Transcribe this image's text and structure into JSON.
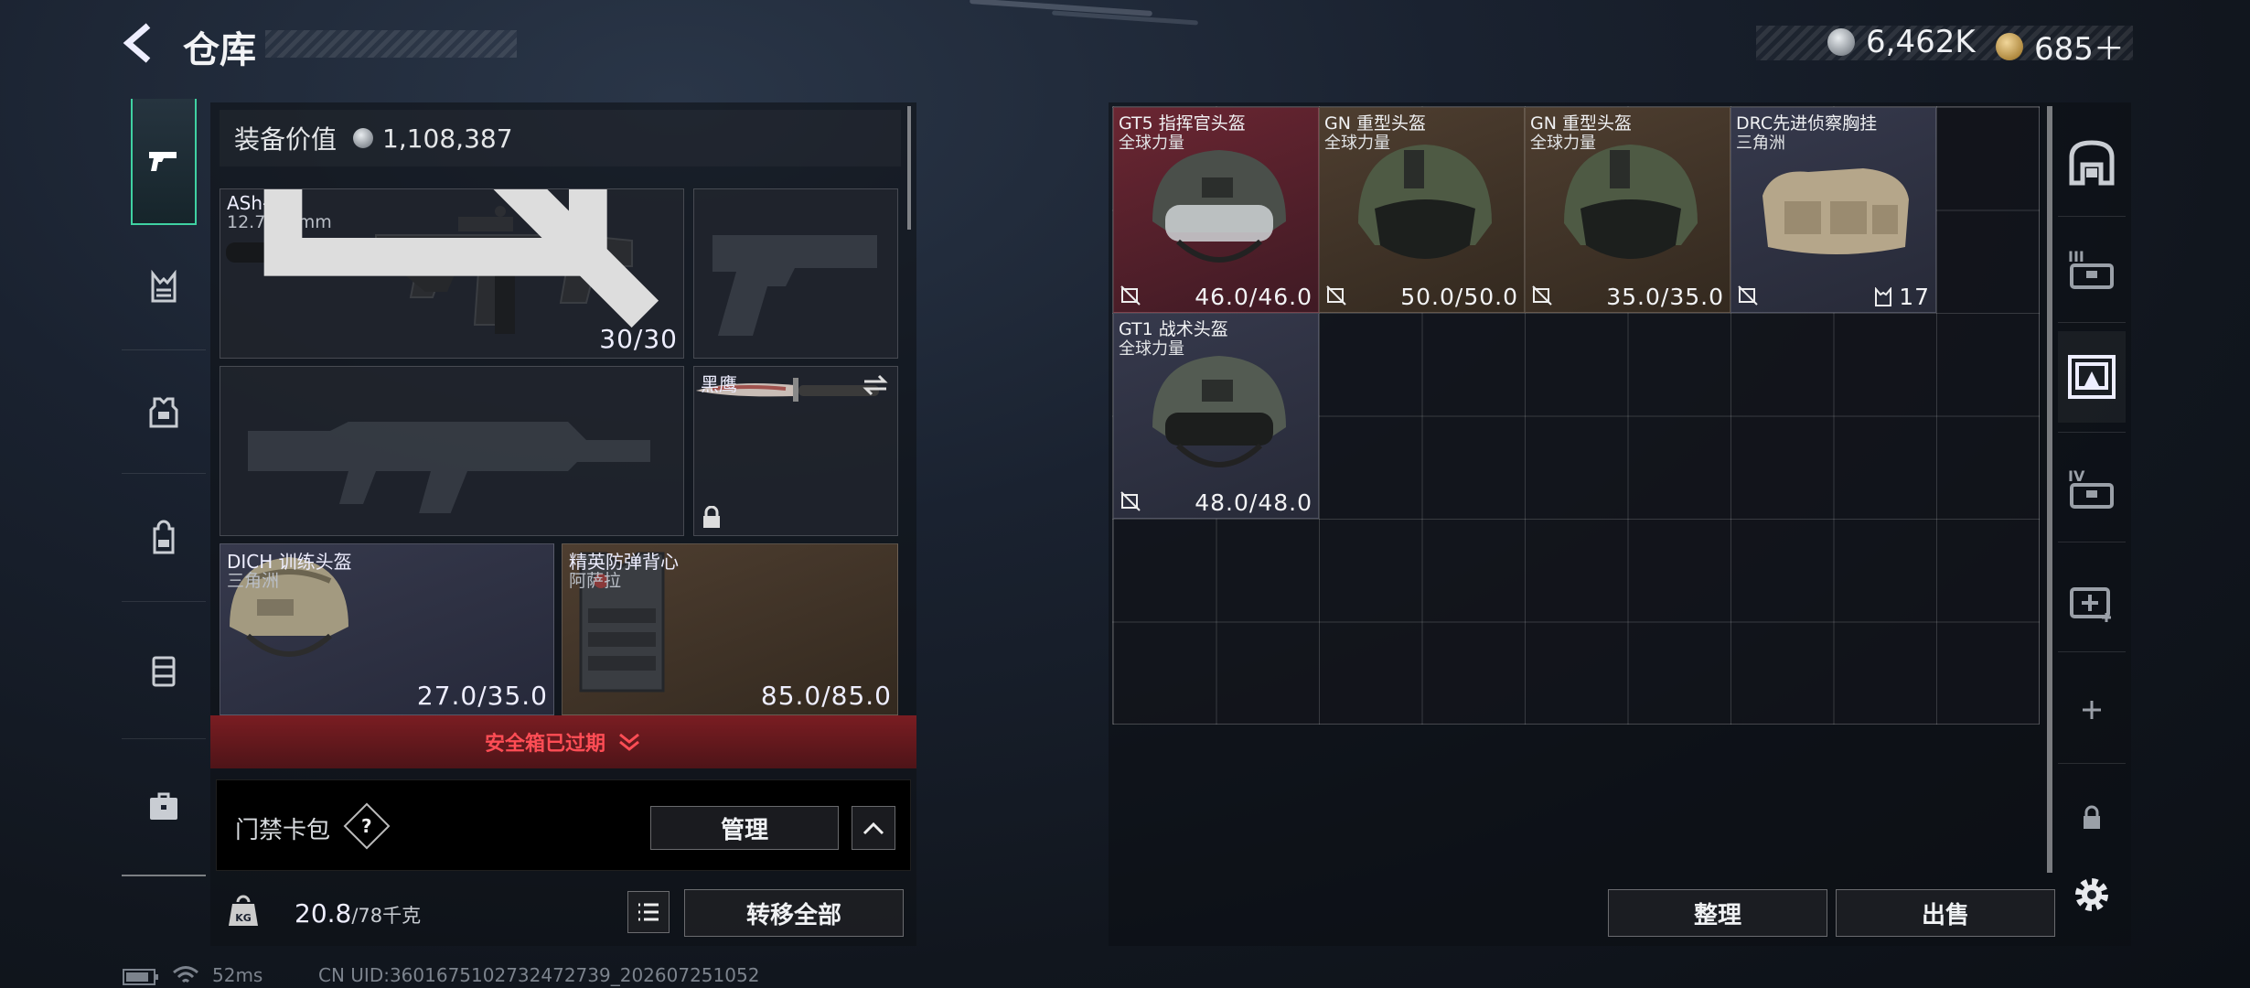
{
  "header": {
    "title": "仓库",
    "currency": {
      "silver": "6,462K",
      "gold": "685＋"
    }
  },
  "left_nav": {
    "items": [
      "pistol-icon",
      "vest-icon",
      "armor-icon",
      "backpack-icon",
      "bag-icon",
      "briefcase-icon"
    ]
  },
  "loadout": {
    "value_label": "装备价值",
    "value": "1,108,387",
    "primary": {
      "name": "ASh-12",
      "caliber": "12.7x55mm",
      "ammo": "30/30"
    },
    "melee": {
      "name": "黑鹰"
    },
    "helmet": {
      "name": "DICH 训练头盔",
      "brand": "三角洲",
      "durability": "27.0/35.0"
    },
    "armor": {
      "name": "精英防弹背心",
      "brand": "阿萨拉",
      "durability": "85.0/85.0"
    },
    "safebox_expired": "安全箱已过期",
    "keycard_label": "门禁卡包",
    "help_label": "?",
    "manage_button": "管理",
    "weight": "20.8",
    "weight_max": "/78千克",
    "transfer_all_button": "转移全部"
  },
  "storage": {
    "items": [
      {
        "name": "GT5 指挥官头盔",
        "brand": "全球力量",
        "durability": "46.0/46.0",
        "color": "#6a2632"
      },
      {
        "name": "GN 重型头盔",
        "brand": "全球力量",
        "durability": "50.0/50.0",
        "color": "#4e3e30"
      },
      {
        "name": "GN 重型头盔",
        "brand": "全球力量",
        "durability": "35.0/35.0",
        "color": "#4e3e30"
      },
      {
        "name": "DRC先进侦察胸挂",
        "brand": "三角洲",
        "capacity": "17",
        "color": "#36394c"
      },
      {
        "name": "GT1 战术头盔",
        "brand": "全球力量",
        "durability": "48.0/48.0",
        "color": "#36394c"
      }
    ],
    "sort_button": "整理",
    "sell_button": "出售"
  },
  "right_rail": {
    "items": [
      "storage-home-icon",
      "case-3-icon",
      "case-active-icon",
      "case-4-icon",
      "case-medical-icon",
      "plus-icon",
      "lock-icon",
      "settings-icon"
    ],
    "case3_label": "III",
    "case4_label": "IV"
  },
  "footer": {
    "ping": "52ms",
    "uid": "CN UID:3601675102732472739_202607251052"
  }
}
